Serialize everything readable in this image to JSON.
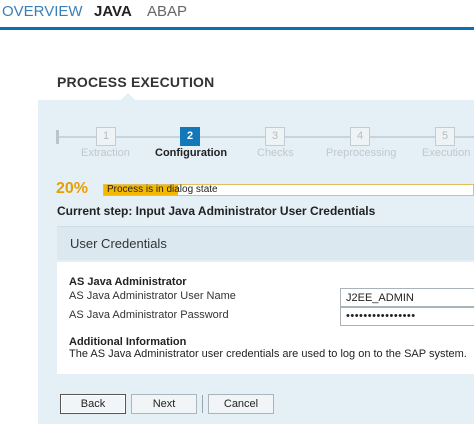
{
  "tabs": [
    {
      "label": "OVERVIEW"
    },
    {
      "label": "JAVA"
    },
    {
      "label": "ABAP"
    }
  ],
  "process": {
    "title": "PROCESS EXECUTION",
    "steps": [
      {
        "num": "1",
        "label": "Extraction"
      },
      {
        "num": "2",
        "label": "Configuration"
      },
      {
        "num": "3",
        "label": "Checks"
      },
      {
        "num": "4",
        "label": "Preprocessing"
      },
      {
        "num": "5",
        "label": "Execution"
      }
    ],
    "progress_percent": 20,
    "progress_label": "20%",
    "progress_text": "Process is in dialog state",
    "current_step": "Current step: Input Java Administrator User Credentials"
  },
  "section": {
    "title": "User Credentials",
    "heading": "AS Java Administrator",
    "username_label": "AS Java Administrator User Name",
    "username_value": "J2EE_ADMIN",
    "password_label": "AS Java Administrator Password",
    "password_value": "••••••••••••••••",
    "info_heading": "Additional Information",
    "info_text": "The AS Java Administrator user credentials are used to log on to the SAP system."
  },
  "buttons": {
    "back": "Back",
    "next": "Next",
    "cancel": "Cancel"
  },
  "colors": {
    "accent": "#0d6fb2",
    "progress": "#f5b800",
    "percent_text": "#e8a000"
  }
}
